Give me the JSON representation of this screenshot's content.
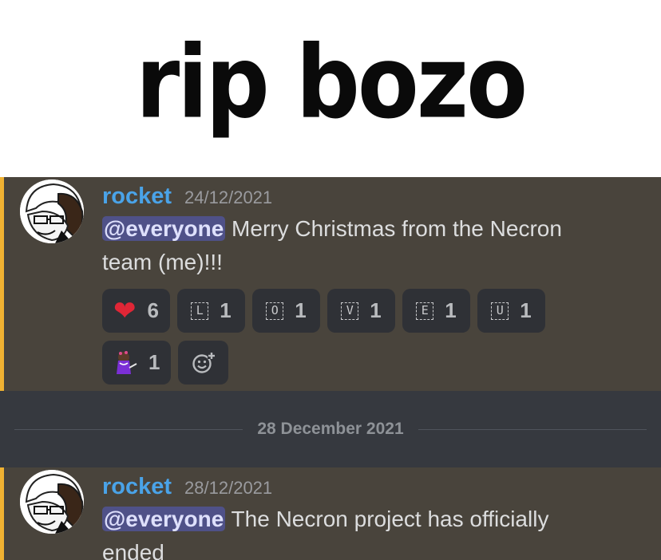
{
  "caption": {
    "text": "rip bozo"
  },
  "messages": [
    {
      "username": "rocket",
      "timestamp": "24/12/2021",
      "mention": "@everyone",
      "text": " Merry Christmas from the Necron team (me)!!!",
      "reactions": [
        {
          "emoji": "heart",
          "count": "6"
        },
        {
          "emoji": "L",
          "count": "1"
        },
        {
          "emoji": "O",
          "count": "1"
        },
        {
          "emoji": "V",
          "count": "1"
        },
        {
          "emoji": "E",
          "count": "1"
        },
        {
          "emoji": "U",
          "count": "1"
        },
        {
          "emoji": "custom-character-emoji",
          "count": "1"
        }
      ]
    },
    {
      "username": "rocket",
      "timestamp": "28/12/2021",
      "mention": "@everyone",
      "text": " The Necron project has officially ended"
    }
  ],
  "date_divider": {
    "label": "28 December 2021"
  },
  "colors": {
    "username": "#4aa3e8",
    "highlight_bar": "#f0b232",
    "highlight_bg": "#49443c",
    "chat_bg": "#36393f",
    "mention_bg": "#5865f2",
    "heart": "#e02636"
  }
}
